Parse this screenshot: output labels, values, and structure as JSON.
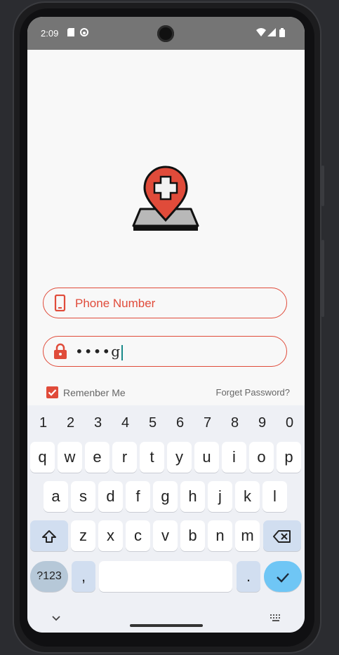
{
  "status_bar": {
    "time": "2:09",
    "left_icons": [
      "sd-card-icon",
      "android-icon"
    ],
    "right_icons": [
      "wifi-icon",
      "signal-icon",
      "battery-icon"
    ]
  },
  "login": {
    "logo_icon": "medical-location-pin-icon",
    "phone_field": {
      "placeholder": "Phone Number",
      "icon": "phone-icon"
    },
    "password_field": {
      "masked_value": "••••",
      "typed_char": "g",
      "icon": "lock-icon"
    },
    "remember_me": {
      "label": "Remenber Me",
      "checked": true
    },
    "forget_password": "Forget Password?"
  },
  "keyboard": {
    "number_row": [
      "1",
      "2",
      "3",
      "4",
      "5",
      "6",
      "7",
      "8",
      "9",
      "0"
    ],
    "row1": [
      "q",
      "w",
      "e",
      "r",
      "t",
      "y",
      "u",
      "i",
      "o",
      "p"
    ],
    "row2": [
      "a",
      "s",
      "d",
      "f",
      "g",
      "h",
      "j",
      "k",
      "l"
    ],
    "row3": [
      "z",
      "x",
      "c",
      "v",
      "b",
      "n",
      "m"
    ],
    "symbols_key": "?123",
    "comma_key": ",",
    "period_key": ".",
    "shift_icon": "shift-icon",
    "backspace_icon": "backspace-icon",
    "enter_icon": "check-icon"
  },
  "nav_bar": {
    "back_icon": "chevron-down-icon",
    "keyboard_switch_icon": "keyboard-icon"
  },
  "colors": {
    "accent": "#e04b3a",
    "status_bar": "#757575",
    "keyboard_bg": "#eef0f5",
    "enter_key": "#6fc6f5"
  }
}
